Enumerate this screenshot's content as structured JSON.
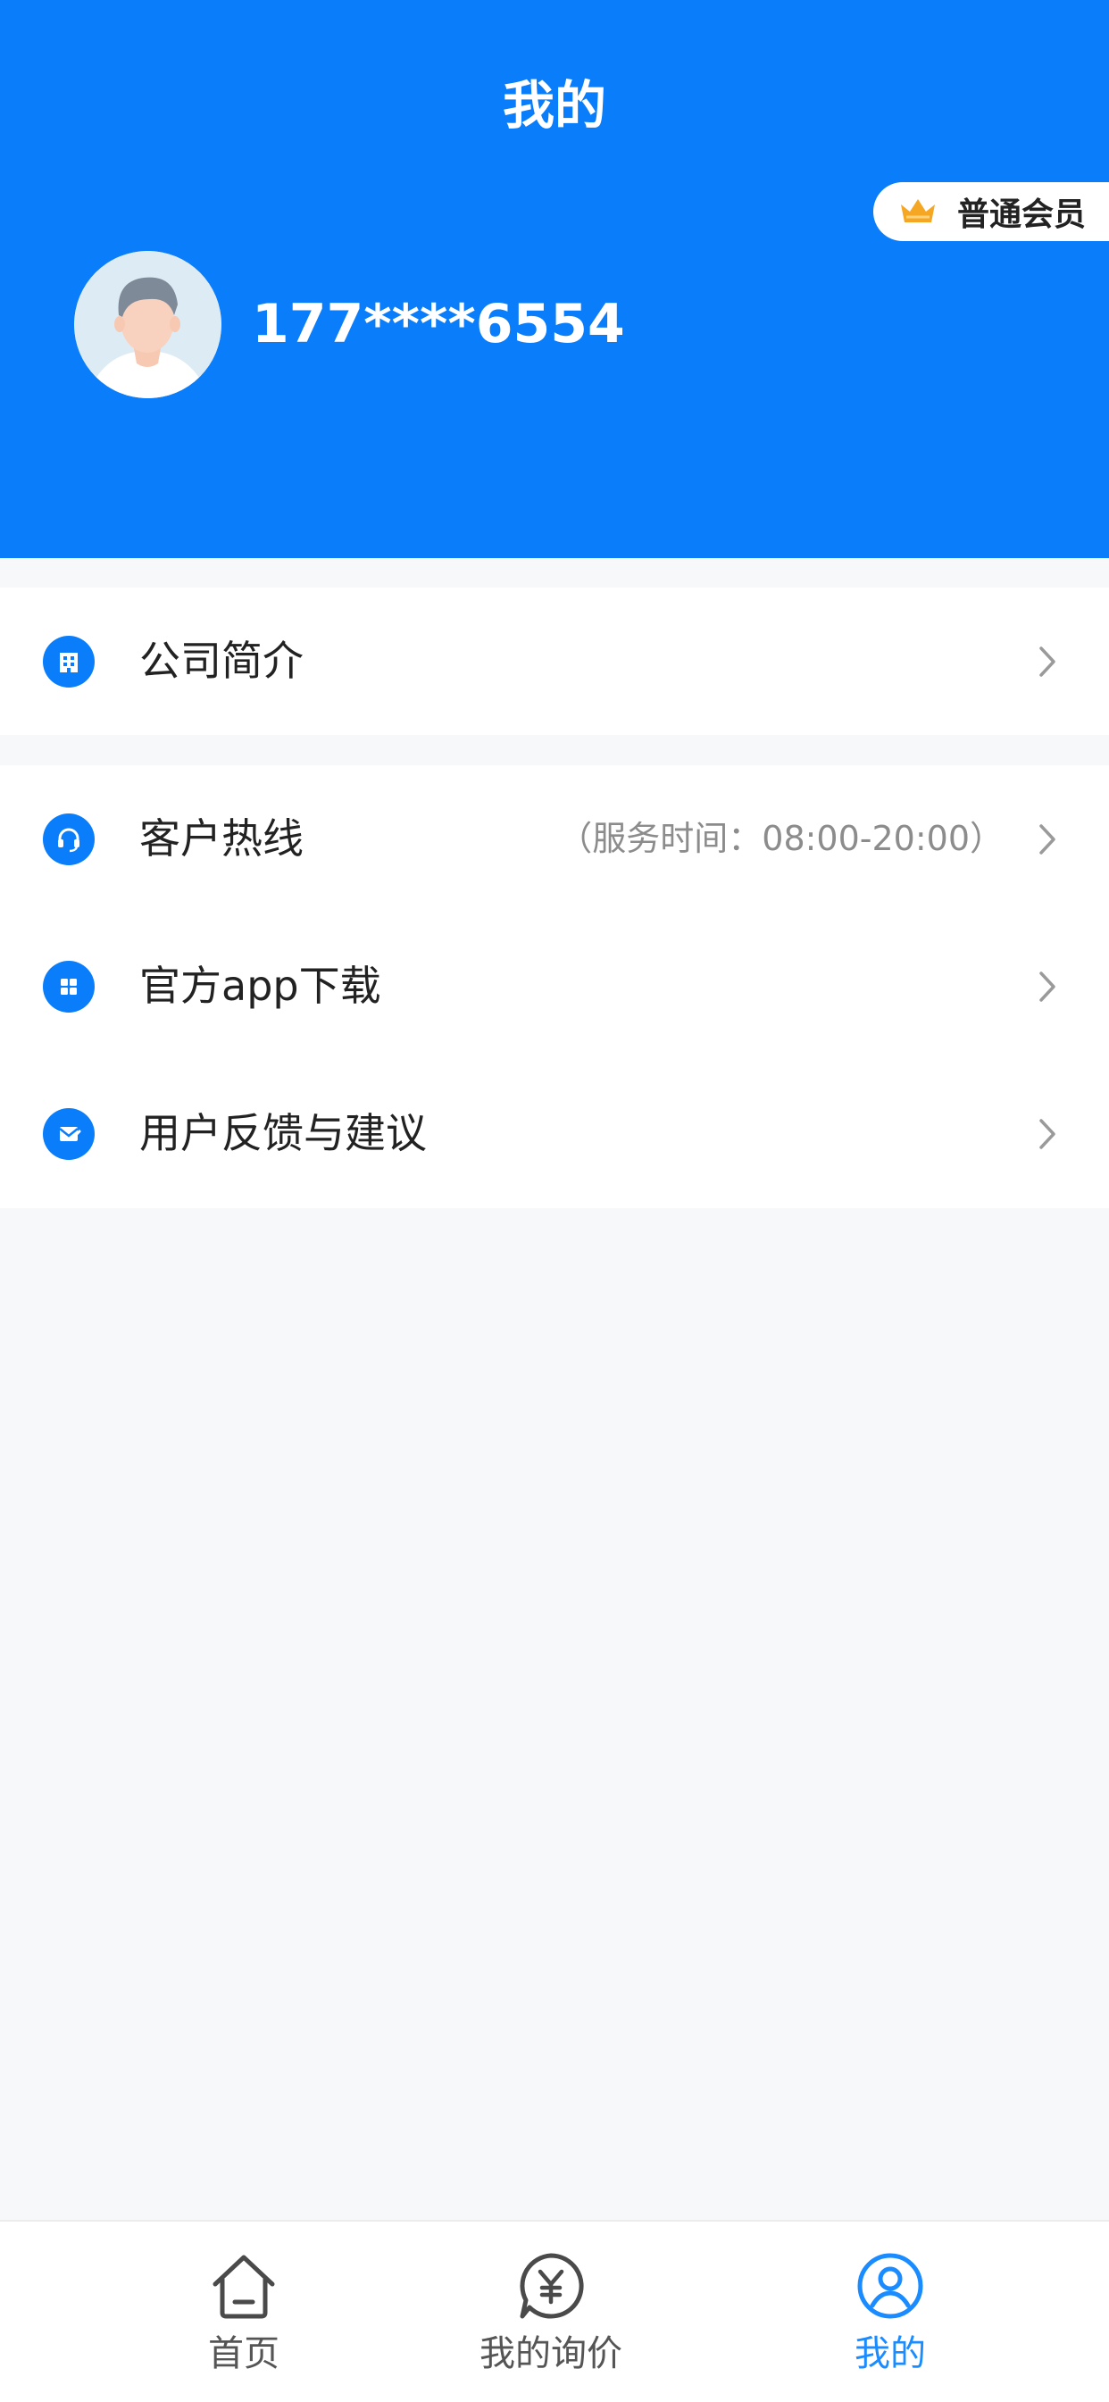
{
  "header": {
    "title": "我的",
    "member_badge": "普通会员",
    "phone": "177****6554"
  },
  "colors": {
    "brand_blue": "#0A7EFA",
    "tab_active": "#1A8CFF",
    "badge_crown": "#F5A623",
    "background": "#F7F8FA"
  },
  "menu": {
    "company": {
      "label": "公司简介",
      "icon": "building-icon"
    },
    "hotline": {
      "label": "客户热线",
      "note": "（服务时间：08:00-20:00）",
      "icon": "headset-icon"
    },
    "download": {
      "label": "官方app下载",
      "icon": "grid-icon"
    },
    "feedback": {
      "label": "用户反馈与建议",
      "icon": "mail-icon"
    }
  },
  "tabbar": {
    "items": [
      {
        "label": "首页",
        "icon": "home-icon",
        "active": false
      },
      {
        "label": "我的询价",
        "icon": "yuan-chat-icon",
        "active": false
      },
      {
        "label": "我的",
        "icon": "user-circle-icon",
        "active": true
      }
    ]
  }
}
